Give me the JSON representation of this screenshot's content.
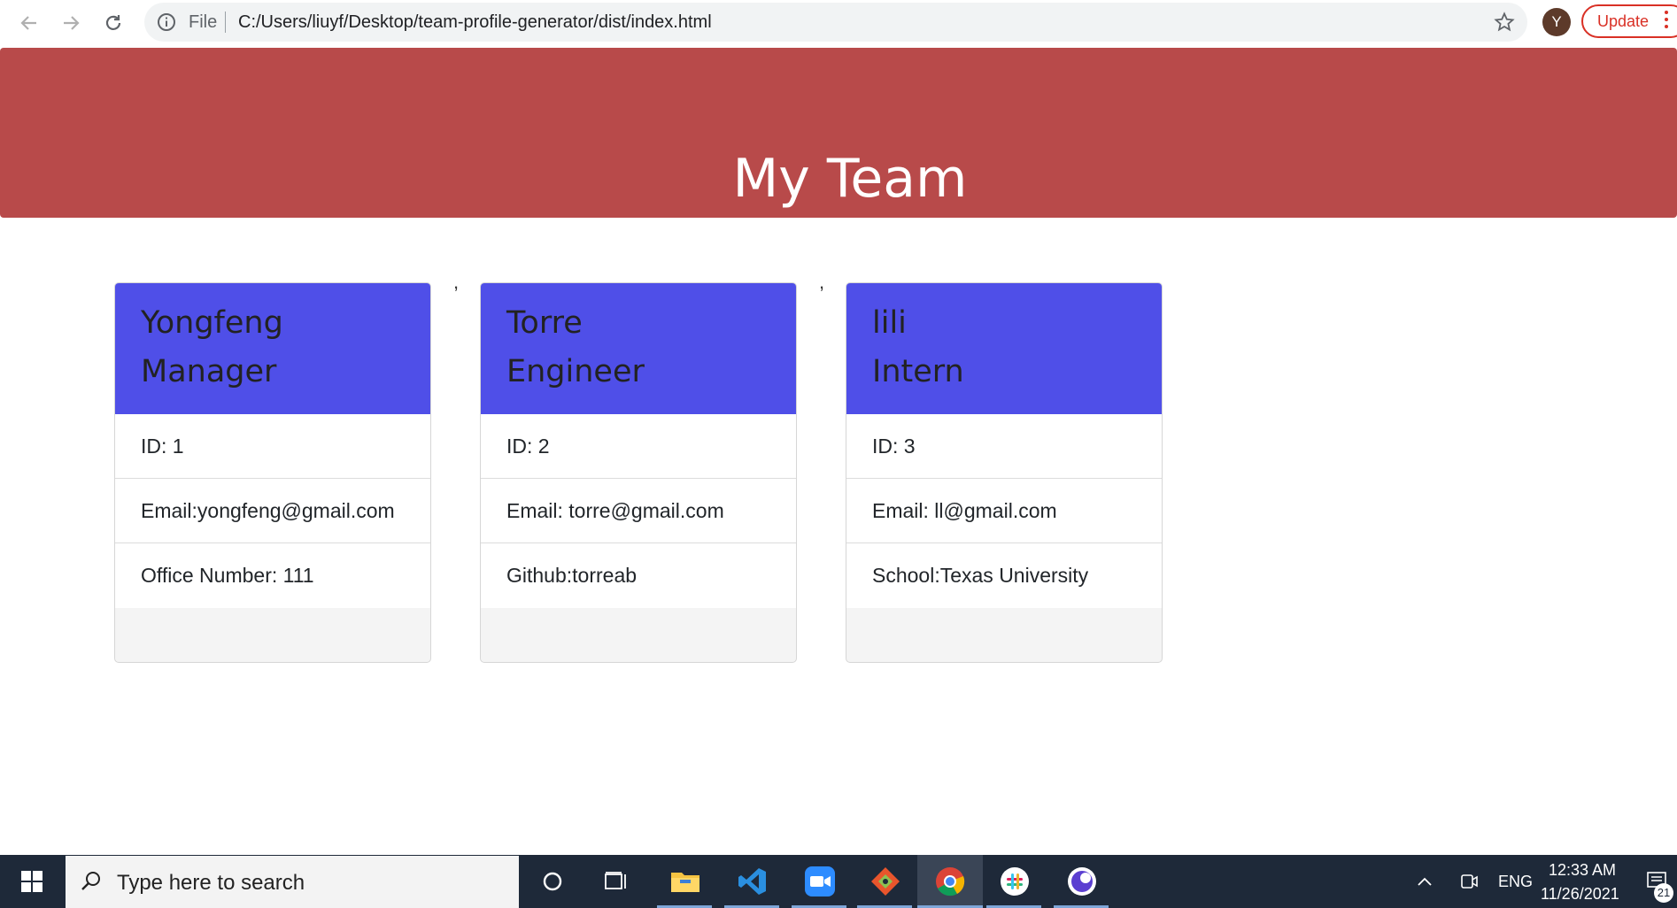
{
  "browser": {
    "file_label": "File",
    "url": "C:/Users/liuyf/Desktop/team-profile-generator/dist/index.html",
    "avatar_letter": "Y",
    "update_label": "Update"
  },
  "page": {
    "title": "My Team",
    "separator": ",",
    "colors": {
      "header": "#b84a4a",
      "card_header": "#4f4fe8"
    },
    "cards": [
      {
        "name": "Yongfeng",
        "role": "Manager",
        "id": "ID: 1",
        "email": "Email:yongfeng@gmail.com",
        "extra": "Office Number: 111"
      },
      {
        "name": "Torre",
        "role": "Engineer",
        "id": "ID: 2",
        "email": "Email: torre@gmail.com",
        "extra": "Github:torreab"
      },
      {
        "name": "lili",
        "role": "Intern",
        "id": "ID: 3",
        "email": "Email: ll@gmail.com",
        "extra": "School:Texas University"
      }
    ]
  },
  "taskbar": {
    "search_placeholder": "Type here to search",
    "apps": [
      "cortana-icon",
      "task-view-icon",
      "file-explorer-icon",
      "vscode-icon",
      "zoom-icon",
      "git-icon",
      "chrome-icon",
      "slack-icon",
      "app-icon"
    ],
    "lang": "ENG",
    "time": "12:33 AM",
    "date": "11/26/2021",
    "notification_count": "21"
  }
}
